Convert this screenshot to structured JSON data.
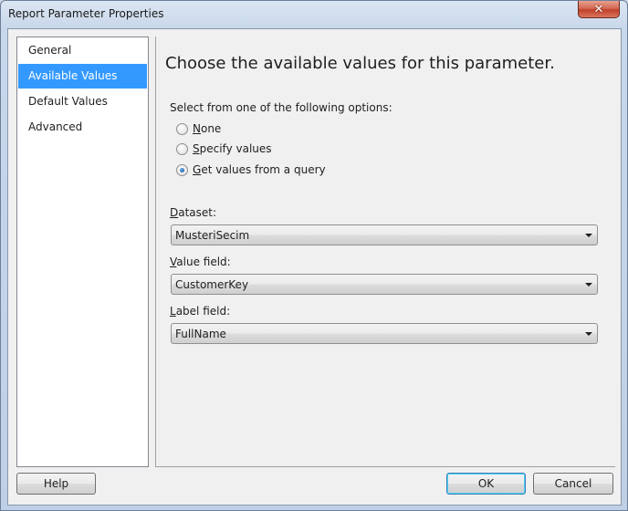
{
  "window": {
    "title": "Report Parameter Properties",
    "close_glyph": "✕"
  },
  "nav": {
    "items": [
      {
        "label": "General",
        "selected": false
      },
      {
        "label": "Available Values",
        "selected": true
      },
      {
        "label": "Default Values",
        "selected": false
      },
      {
        "label": "Advanced",
        "selected": false
      }
    ]
  },
  "main": {
    "heading": "Choose the available values for this parameter.",
    "options_prompt": "Select from one of the following options:",
    "options": [
      {
        "label_rest": "one",
        "accel": "N",
        "checked": false
      },
      {
        "label_rest": "pecify values",
        "accel": "S",
        "checked": false
      },
      {
        "label_rest": "et values from a query",
        "accel": "G",
        "checked": true
      }
    ],
    "dataset": {
      "accel": "D",
      "label_rest": "ataset:",
      "value": "MusteriSecim"
    },
    "value_field": {
      "accel": "V",
      "label_rest": "alue field:",
      "value": "CustomerKey"
    },
    "label_field": {
      "accel": "L",
      "label_rest": "abel field:",
      "value": "FullName"
    }
  },
  "buttons": {
    "help": "Help",
    "ok": "OK",
    "cancel": "Cancel"
  },
  "colors": {
    "selection": "#3399ff",
    "client_bg": "#f0f0f0"
  }
}
